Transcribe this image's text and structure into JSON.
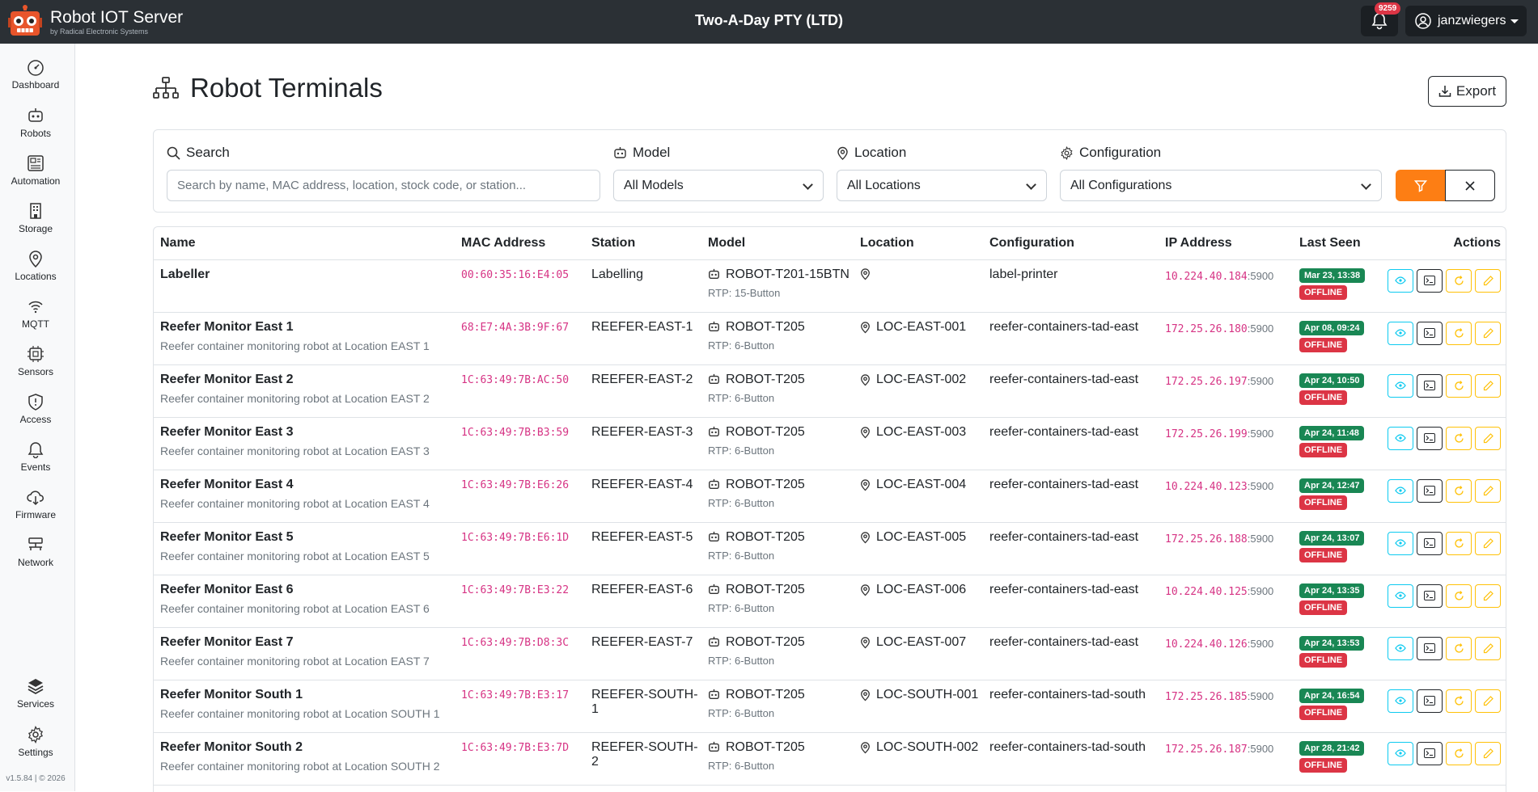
{
  "brand": {
    "title": "Robot IOT Server",
    "subtitle": "by Radical Electronic Systems"
  },
  "header": {
    "org": "Two-A-Day PTY (LTD)",
    "notifications": "9259",
    "username": "janzwiegers"
  },
  "sidebar": {
    "items": [
      {
        "label": "Dashboard",
        "icon": "dashboard-icon"
      },
      {
        "label": "Robots",
        "icon": "robot-icon"
      },
      {
        "label": "Automation",
        "icon": "automation-icon"
      },
      {
        "label": "Storage",
        "icon": "storage-icon"
      },
      {
        "label": "Locations",
        "icon": "location-pin-icon"
      },
      {
        "label": "MQTT",
        "icon": "wifi-icon"
      },
      {
        "label": "Sensors",
        "icon": "cpu-icon"
      },
      {
        "label": "Access",
        "icon": "shield-icon"
      },
      {
        "label": "Events",
        "icon": "bell-icon"
      },
      {
        "label": "Firmware",
        "icon": "cloud-download-icon"
      },
      {
        "label": "Network",
        "icon": "network-icon"
      }
    ],
    "bottom": [
      {
        "label": "Services",
        "icon": "layers-icon"
      },
      {
        "label": "Settings",
        "icon": "gear-icon"
      }
    ],
    "version": "v1.5.84 | © 2026"
  },
  "page": {
    "title": "Robot Terminals",
    "export_label": "Export"
  },
  "filters": {
    "search_label": "Search",
    "search_placeholder": "Search by name, MAC address, location, stock code, or station...",
    "model_label": "Model",
    "model_value": "All Models",
    "location_label": "Location",
    "location_value": "All Locations",
    "config_label": "Configuration",
    "config_value": "All Configurations"
  },
  "table": {
    "headers": [
      "Name",
      "MAC Address",
      "Station",
      "Model",
      "Location",
      "Configuration",
      "IP Address",
      "Last Seen",
      "Actions"
    ],
    "status_label": "OFFLINE",
    "rows": [
      {
        "name": "Labeller",
        "desc": "",
        "mac": "00:60:35:16:E4:05",
        "station": "Labelling",
        "model": "ROBOT-T201-15BTN",
        "rtp": "RTP: 15-Button",
        "location": "",
        "config": "label-printer",
        "ip": "10.224.40.184",
        "port": ":5900",
        "seen": "Mar 23, 13:38"
      },
      {
        "name": "Reefer Monitor East 1",
        "desc": "Reefer container monitoring robot at Location EAST 1",
        "mac": "68:E7:4A:3B:9F:67",
        "station": "REEFER-EAST-1",
        "model": "ROBOT-T205",
        "rtp": "RTP: 6-Button",
        "location": "LOC-EAST-001",
        "config": "reefer-containers-tad-east",
        "ip": "172.25.26.180",
        "port": ":5900",
        "seen": "Apr 08, 09:24"
      },
      {
        "name": "Reefer Monitor East 2",
        "desc": "Reefer container monitoring robot at Location EAST 2",
        "mac": "1C:63:49:7B:AC:50",
        "station": "REEFER-EAST-2",
        "model": "ROBOT-T205",
        "rtp": "RTP: 6-Button",
        "location": "LOC-EAST-002",
        "config": "reefer-containers-tad-east",
        "ip": "172.25.26.197",
        "port": ":5900",
        "seen": "Apr 24, 10:50"
      },
      {
        "name": "Reefer Monitor East 3",
        "desc": "Reefer container monitoring robot at Location EAST 3",
        "mac": "1C:63:49:7B:B3:59",
        "station": "REEFER-EAST-3",
        "model": "ROBOT-T205",
        "rtp": "RTP: 6-Button",
        "location": "LOC-EAST-003",
        "config": "reefer-containers-tad-east",
        "ip": "172.25.26.199",
        "port": ":5900",
        "seen": "Apr 24, 11:48"
      },
      {
        "name": "Reefer Monitor East 4",
        "desc": "Reefer container monitoring robot at Location EAST 4",
        "mac": "1C:63:49:7B:E6:26",
        "station": "REEFER-EAST-4",
        "model": "ROBOT-T205",
        "rtp": "RTP: 6-Button",
        "location": "LOC-EAST-004",
        "config": "reefer-containers-tad-east",
        "ip": "10.224.40.123",
        "port": ":5900",
        "seen": "Apr 24, 12:47"
      },
      {
        "name": "Reefer Monitor East 5",
        "desc": "Reefer container monitoring robot at Location EAST 5",
        "mac": "1C:63:49:7B:E6:1D",
        "station": "REEFER-EAST-5",
        "model": "ROBOT-T205",
        "rtp": "RTP: 6-Button",
        "location": "LOC-EAST-005",
        "config": "reefer-containers-tad-east",
        "ip": "172.25.26.188",
        "port": ":5900",
        "seen": "Apr 24, 13:07"
      },
      {
        "name": "Reefer Monitor East 6",
        "desc": "Reefer container monitoring robot at Location EAST 6",
        "mac": "1C:63:49:7B:E3:22",
        "station": "REEFER-EAST-6",
        "model": "ROBOT-T205",
        "rtp": "RTP: 6-Button",
        "location": "LOC-EAST-006",
        "config": "reefer-containers-tad-east",
        "ip": "10.224.40.125",
        "port": ":5900",
        "seen": "Apr 24, 13:35"
      },
      {
        "name": "Reefer Monitor East 7",
        "desc": "Reefer container monitoring robot at Location EAST 7",
        "mac": "1C:63:49:7B:D8:3C",
        "station": "REEFER-EAST-7",
        "model": "ROBOT-T205",
        "rtp": "RTP: 6-Button",
        "location": "LOC-EAST-007",
        "config": "reefer-containers-tad-east",
        "ip": "10.224.40.126",
        "port": ":5900",
        "seen": "Apr 24, 13:53"
      },
      {
        "name": "Reefer Monitor South 1",
        "desc": "Reefer container monitoring robot at Location SOUTH 1",
        "mac": "1C:63:49:7B:E3:17",
        "station": "REEFER-SOUTH-1",
        "model": "ROBOT-T205",
        "rtp": "RTP: 6-Button",
        "location": "LOC-SOUTH-001",
        "config": "reefer-containers-tad-south",
        "ip": "172.25.26.185",
        "port": ":5900",
        "seen": "Apr 24, 16:54"
      },
      {
        "name": "Reefer Monitor South 2",
        "desc": "Reefer container monitoring robot at Location SOUTH 2",
        "mac": "1C:63:49:7B:E3:7D",
        "station": "REEFER-SOUTH-2",
        "model": "ROBOT-T205",
        "rtp": "RTP: 6-Button",
        "location": "LOC-SOUTH-002",
        "config": "reefer-containers-tad-south",
        "ip": "172.25.26.187",
        "port": ":5900",
        "seen": "Apr 28, 21:42"
      }
    ]
  },
  "colors": {
    "topbar": "#2b3035",
    "accent": "#fd7e14",
    "mono": "#d63384",
    "success": "#198754",
    "danger": "#dc3545",
    "info": "#0dcaf0",
    "warning": "#ffc107"
  }
}
